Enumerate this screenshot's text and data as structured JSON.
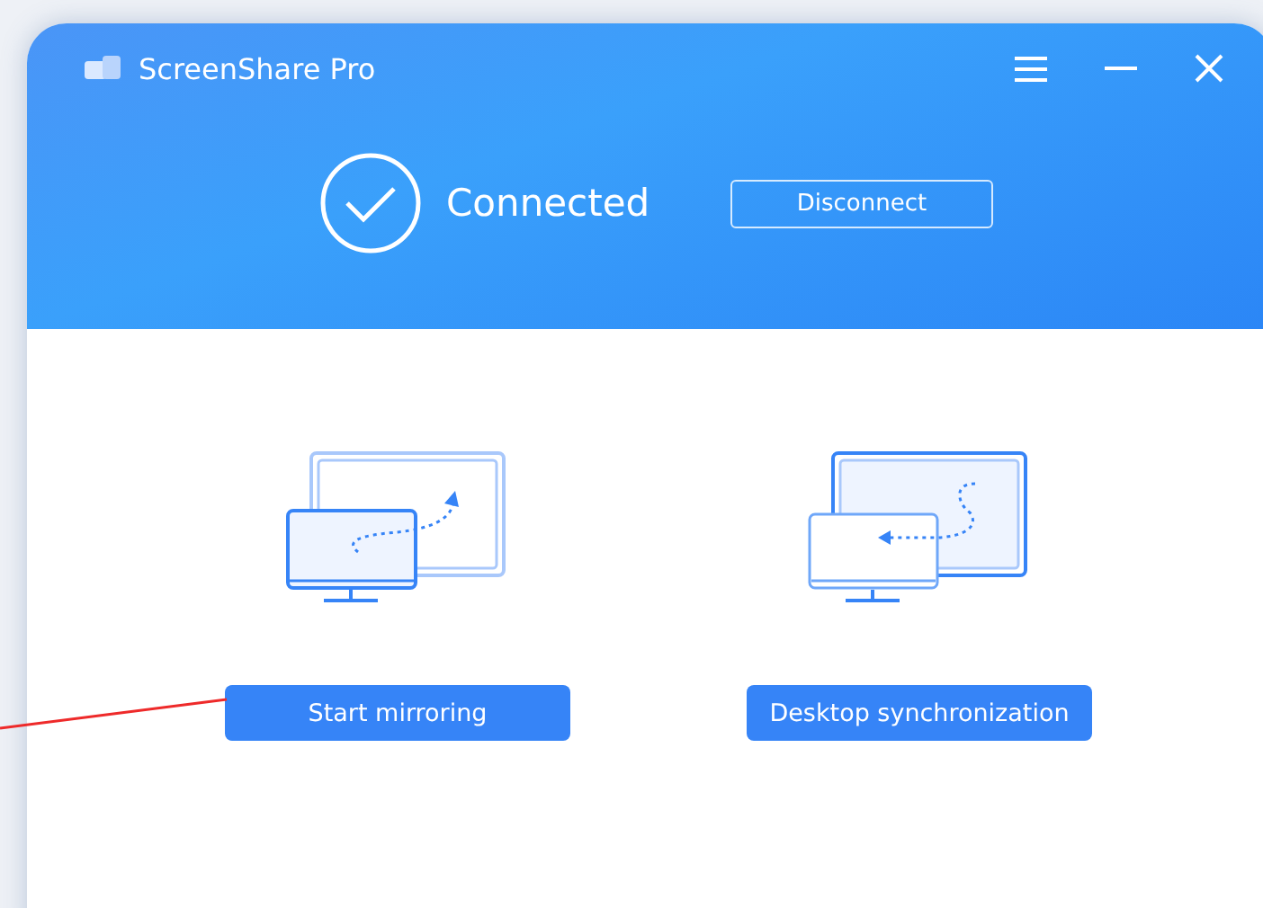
{
  "window": {
    "title": "ScreenShare Pro"
  },
  "status": {
    "label": "Connected",
    "connected": true
  },
  "disconnect_button": "Disconnect",
  "actions": [
    {
      "kind": "mirror",
      "label": "Start mirroring"
    },
    {
      "kind": "sync",
      "label": "Desktop synchronization"
    }
  ]
}
